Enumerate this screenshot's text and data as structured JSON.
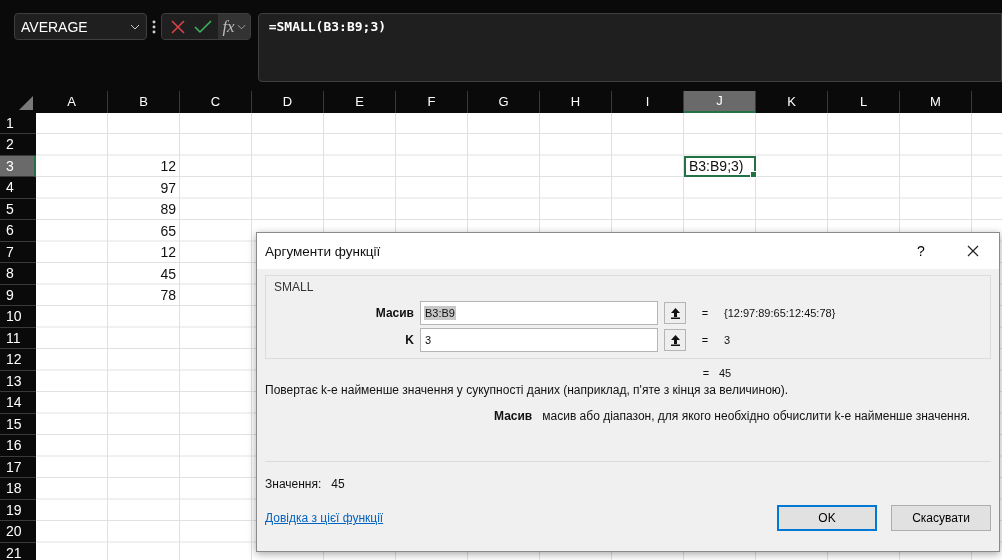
{
  "name_box": {
    "value": "AVERAGE"
  },
  "formula_bar": {
    "value": "=SMALL(B3:B9;3)",
    "fx": "fx"
  },
  "sheet": {
    "columns": [
      {
        "label": "A",
        "selected": false
      },
      {
        "label": "B",
        "selected": false
      },
      {
        "label": "C",
        "selected": false
      },
      {
        "label": "D",
        "selected": false
      },
      {
        "label": "E",
        "selected": false
      },
      {
        "label": "F",
        "selected": false
      },
      {
        "label": "G",
        "selected": false
      },
      {
        "label": "H",
        "selected": false
      },
      {
        "label": "I",
        "selected": false
      },
      {
        "label": "J",
        "selected": true
      },
      {
        "label": "K",
        "selected": false
      },
      {
        "label": "L",
        "selected": false
      },
      {
        "label": "M",
        "selected": false
      }
    ],
    "rows": [
      {
        "label": "1",
        "selected": false
      },
      {
        "label": "2",
        "selected": false
      },
      {
        "label": "3",
        "selected": true,
        "cells": [
          null,
          "12",
          null,
          null,
          null,
          null,
          null,
          null,
          null,
          "B3:B9;3)"
        ]
      },
      {
        "label": "4",
        "selected": false,
        "cells": [
          null,
          "97"
        ]
      },
      {
        "label": "5",
        "selected": false,
        "cells": [
          null,
          "89"
        ]
      },
      {
        "label": "6",
        "selected": false,
        "cells": [
          null,
          "65"
        ]
      },
      {
        "label": "7",
        "selected": false,
        "cells": [
          null,
          "12"
        ]
      },
      {
        "label": "8",
        "selected": false,
        "cells": [
          null,
          "45"
        ]
      },
      {
        "label": "9",
        "selected": false,
        "cells": [
          null,
          "78"
        ]
      },
      {
        "label": "10",
        "selected": false
      },
      {
        "label": "11",
        "selected": false
      },
      {
        "label": "12",
        "selected": false
      },
      {
        "label": "13",
        "selected": false
      },
      {
        "label": "14",
        "selected": false
      },
      {
        "label": "15",
        "selected": false
      },
      {
        "label": "16",
        "selected": false
      },
      {
        "label": "17",
        "selected": false
      },
      {
        "label": "18",
        "selected": false
      },
      {
        "label": "19",
        "selected": false
      },
      {
        "label": "20",
        "selected": false
      },
      {
        "label": "21",
        "selected": false
      }
    ]
  },
  "dialog": {
    "title": "Аргументи функції",
    "help": "?",
    "function_name": "SMALL",
    "arguments": [
      {
        "label": "Масив",
        "value": "B3:B9",
        "selected": true,
        "result": "{12:97:89:65:12:45:78}"
      },
      {
        "label": "K",
        "value": "3",
        "selected": false,
        "result": "3"
      }
    ],
    "equals": "=",
    "result": "45",
    "description": "Повертає k-е найменше значення у сукупності даних (наприклад, п'яте з кінця за величиною).",
    "argument_help": {
      "label": "Масив",
      "text": "масив або діапазон, для якого необхідно обчислити k-е найменше значення."
    },
    "value_label": "Значення:",
    "value": "45",
    "help_link": "Довідка з цієї функції",
    "ok": "OK",
    "cancel": "Скасувати"
  }
}
